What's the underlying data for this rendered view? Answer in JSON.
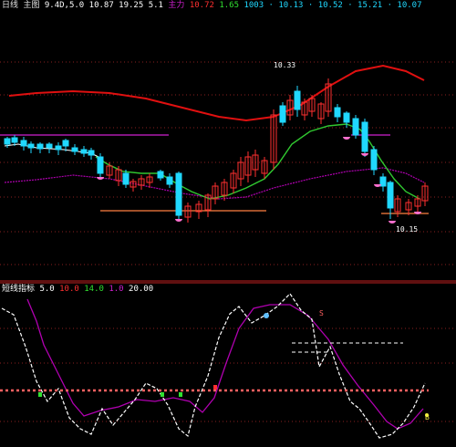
{
  "colors": {
    "background": "#000000",
    "grid": "#8a2020",
    "divider": "#c02020",
    "up": "#ff3030",
    "down": "#20d8ff",
    "long_ma": "#e01010",
    "short_ma": "#30c830",
    "purple": "#b000b0",
    "support": "#ff8040",
    "resistance": "#d020d0",
    "white": "#ffffff",
    "pink_dots": "#ff6060",
    "yellow": "#f0f040",
    "green": "#30e030"
  },
  "top_header": {
    "indicator": "日线",
    "main": "主图",
    "value_a": "9.4D,5.0",
    "value_b": "10.87",
    "value_c": "19.25",
    "value_d": "5.1",
    "tag_purple": "主力",
    "tag_red": "10.72",
    "tag_green": "1.65",
    "tail": "1003 · 10.13 · 10.52 · 15.21 · 10.07"
  },
  "top_chart": {
    "high_label": "10.33",
    "low_label": "10.15"
  },
  "sub_header": {
    "title": "短线指标",
    "v1": "5.0",
    "v2": "10.0",
    "v3": "14.0",
    "v4": "1.0",
    "v5": "20.00"
  },
  "sub_chart": {
    "marker_b": "B",
    "marker_s": "S"
  }
}
